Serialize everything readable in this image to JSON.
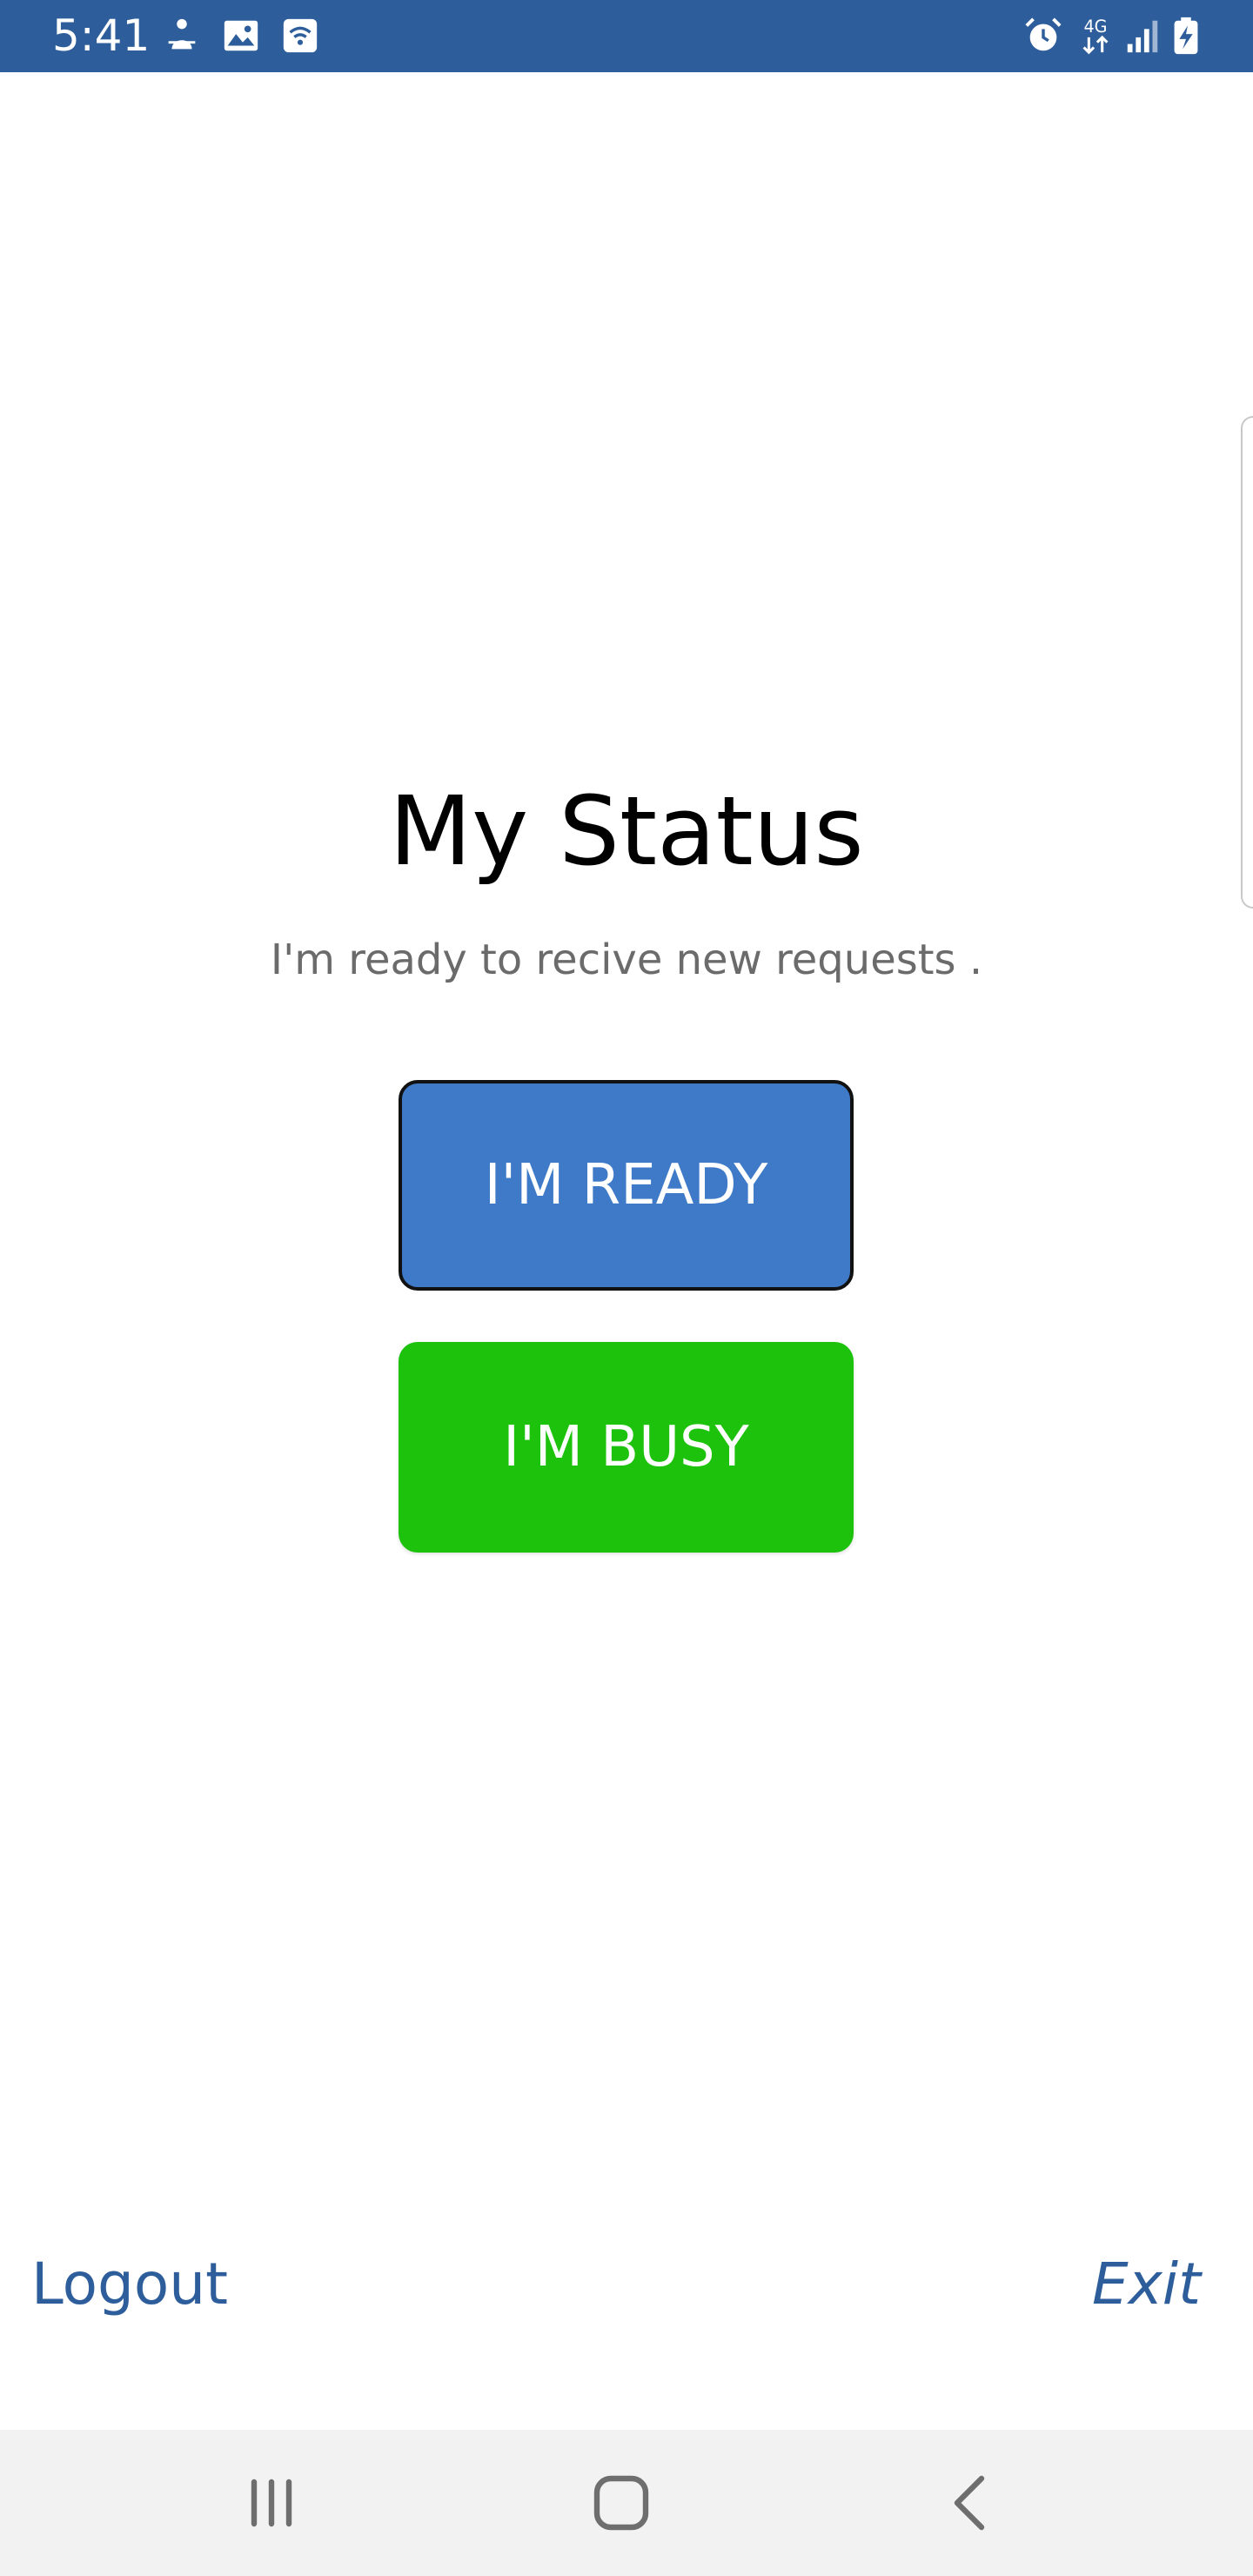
{
  "status_bar": {
    "time": "5:41",
    "background": "#2d5e9b",
    "left_icons": [
      "person-notification-icon",
      "image-icon",
      "wifi-icon"
    ],
    "right_icons": [
      "alarm-icon",
      "network-4g-icon",
      "signal-icon",
      "battery-charging-icon"
    ],
    "network_label": "4G"
  },
  "main": {
    "title": "My Status",
    "message": "I'm ready to recive new requests .",
    "ready_button": {
      "label": "I'M READY",
      "color": "#3e7ac8"
    },
    "busy_button": {
      "label": "I'M BUSY",
      "color": "#1cc20c"
    }
  },
  "footer": {
    "logout_label": "Logout",
    "exit_label": "Exit",
    "link_color": "#2d5e9b"
  },
  "nav_bar": {
    "buttons": [
      "recent-apps-icon",
      "home-icon",
      "back-icon"
    ]
  }
}
